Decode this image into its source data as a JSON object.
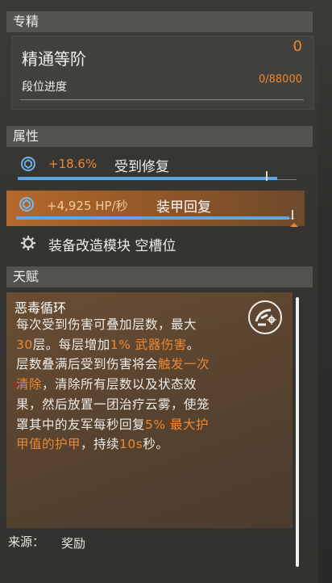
{
  "specialization": {
    "section_title": "专精",
    "mastery_label": "精通等阶",
    "mastery_value": "0",
    "progress_label": "段位进度",
    "progress_value": "0/88000"
  },
  "attributes": {
    "section_title": "属性",
    "rows": [
      {
        "value": "+18.6%",
        "label": "受到修复",
        "fill": 0.93,
        "highlighted": false,
        "icon": "shield-repair-icon"
      },
      {
        "value": "+4,925 HP/秒",
        "label": "装甲回复",
        "fill": 0.98,
        "highlighted": true,
        "icon": "shield-repair-icon"
      }
    ],
    "mod_slot_label": "装备改造模块 空槽位",
    "mod_icon": "gear-icon"
  },
  "talent": {
    "section_title": "天赋",
    "name": "恶毒循环",
    "desc": {
      "p1": "每次受到伤害可叠加层数，最大",
      "n1": "30",
      "p2": "层。每层增加",
      "n2": "1% 武器伤害",
      "p3": "。层数叠满后受到伤害将会",
      "n3": "触发一次清除",
      "p4": "，清除所有层数以及状态效果，然后放置一团治疗云雾，使笼罩其中的友军每秒回复",
      "n4": "5% 最大护甲值的护甲",
      "p5": "，持续",
      "n5": "10s",
      "p6": "秒。"
    },
    "icon": "vicious-cycle-icon"
  },
  "source": {
    "label": "来源：",
    "value": "奖励"
  },
  "colors": {
    "accent": "#ee8730",
    "bar": "#5fa6e6",
    "highlight_row": "#b5692a"
  }
}
